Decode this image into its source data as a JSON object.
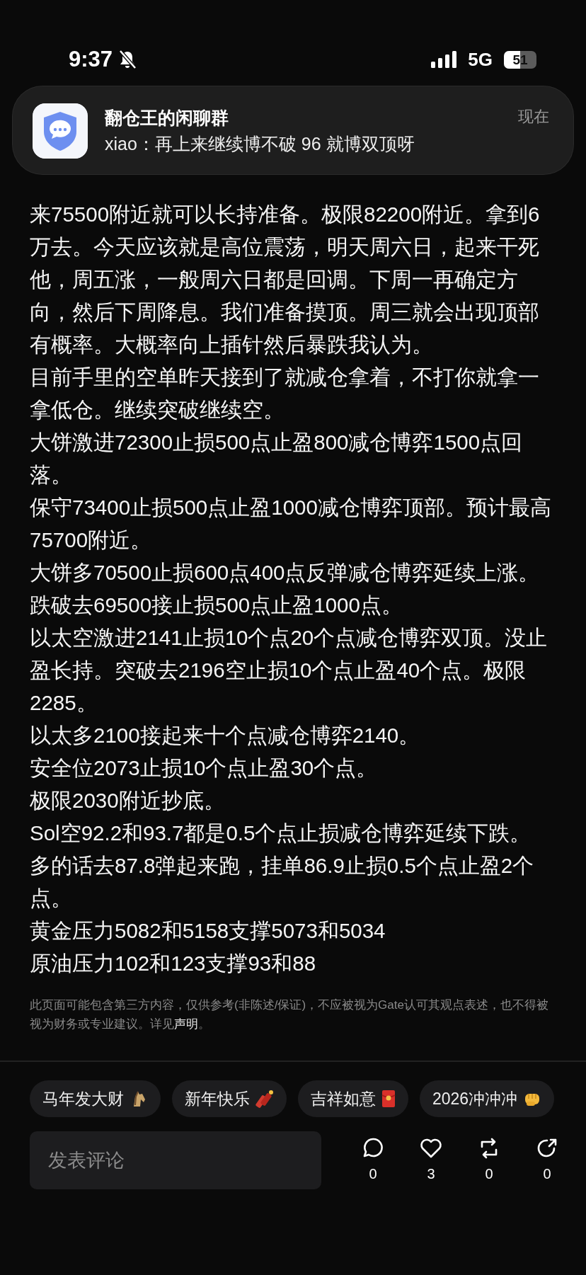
{
  "status_bar": {
    "time": "9:37",
    "network": "5G",
    "battery": "51"
  },
  "notification": {
    "app_name": "翻仓王的闲聊群",
    "message": "xiao：再上来继续博不破 96 就博双顶呀",
    "time": "现在"
  },
  "post": {
    "paragraphs": [
      "来75500附近就可以长持准备。极限82200附近。拿到6万去。今天应该就是高位震荡，明天周六日，起来干死他，周五涨，一般周六日都是回调。下周一再确定方向，然后下周降息。我们准备摸顶。周三就会出现顶部有概率。大概率向上插针然后暴跌我认为。",
      "目前手里的空单昨天接到了就减仓拿着，不打你就拿一拿低仓。继续突破继续空。",
      "大饼激进72300止损500点止盈800减仓博弈1500点回落。",
      "保守73400止损500点止盈1000减仓博弈顶部。预计最高75700附近。",
      "大饼多70500止损600点400点反弹减仓博弈延续上涨。",
      "跌破去69500接止损500点止盈1000点。",
      "以太空激进2141止损10个点20个点减仓博弈双顶。没止盈长持。突破去2196空止损10个点止盈40个点。极限2285。",
      "以太多2100接起来十个点减仓博弈2140。",
      "安全位2073止损10个点止盈30个点。",
      "极限2030附近抄底。",
      "Sol空92.2和93.7都是0.5个点止损减仓博弈延续下跌。",
      "多的话去87.8弹起来跑，挂单86.9止损0.5个点止盈2个点。",
      "黄金压力5082和5158支撑5073和5034",
      "原油压力102和123支撑93和88"
    ]
  },
  "disclaimer": {
    "text": "此页面可能包含第三方内容，仅供参考(非陈述/保证)，不应被视为Gate认可其观点表述，也不得被视为财务或专业建议。详见",
    "link": "声明",
    "end": "。"
  },
  "reaction_tags": [
    {
      "label": "马年发大财",
      "kind": "horse"
    },
    {
      "label": "新年快乐",
      "kind": "firecracker"
    },
    {
      "label": "吉祥如意",
      "kind": "envelope"
    },
    {
      "label": "2026冲冲冲",
      "kind": "fist"
    }
  ],
  "comment_field": {
    "placeholder": "发表评论"
  },
  "actions": [
    {
      "kind": "comment",
      "count": "0"
    },
    {
      "kind": "like",
      "count": "3"
    },
    {
      "kind": "repost",
      "count": "0"
    },
    {
      "kind": "share",
      "count": "0"
    }
  ]
}
